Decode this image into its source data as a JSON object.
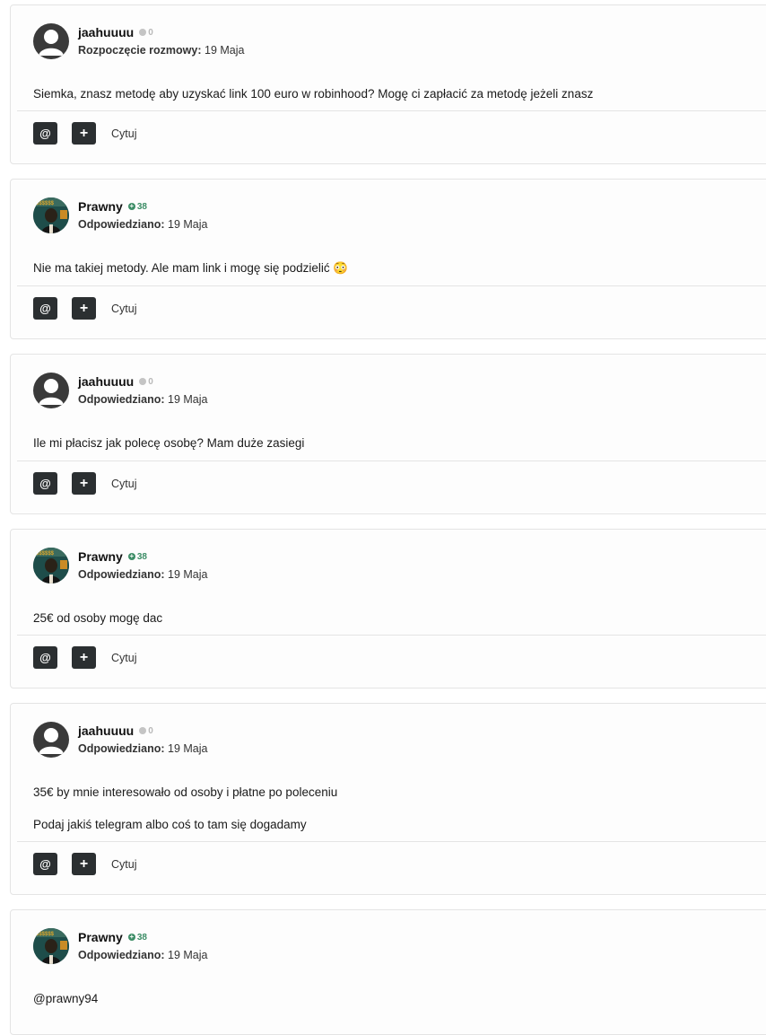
{
  "posts": [
    {
      "author": "jaahuuuu",
      "avatar_type": "default-avatar",
      "reputation": "0",
      "rep_type": "neutral",
      "meta_label": "Rozpoczęcie rozmowy:",
      "date": "19 Maja",
      "paragraphs": [
        "Siemka, znasz metodę aby uzyskać link 100 euro w robinhood? Mogę ci zapłacić za metodę jeżeli znasz"
      ]
    },
    {
      "author": "Prawny",
      "avatar_type": "photo-avatar",
      "reputation": "38",
      "rep_type": "positive",
      "meta_label": "Odpowiedziano:",
      "date": "19 Maja",
      "paragraphs": [
        "Nie ma takiej metody. Ale mam link i mogę się podzielić 😳"
      ]
    },
    {
      "author": "jaahuuuu",
      "avatar_type": "default-avatar",
      "reputation": "0",
      "rep_type": "neutral",
      "meta_label": "Odpowiedziano:",
      "date": "19 Maja",
      "paragraphs": [
        "Ile mi płacisz jak polecę osobę? Mam duże zasiegi"
      ]
    },
    {
      "author": "Prawny",
      "avatar_type": "photo-avatar",
      "reputation": "38",
      "rep_type": "positive",
      "meta_label": "Odpowiedziano:",
      "date": "19 Maja",
      "paragraphs": [
        "25€ od osoby mogę dac"
      ]
    },
    {
      "author": "jaahuuuu",
      "avatar_type": "default-avatar",
      "reputation": "0",
      "rep_type": "neutral",
      "meta_label": "Odpowiedziano:",
      "date": "19 Maja",
      "paragraphs": [
        "35€  by mnie interesowało od osoby i płatne po poleceniu",
        "Podaj jakiś telegram albo coś to tam się dogadamy"
      ]
    },
    {
      "author": "Prawny",
      "avatar_type": "photo-avatar",
      "reputation": "38",
      "rep_type": "positive",
      "meta_label": "Odpowiedziano:",
      "date": "19 Maja",
      "paragraphs": [
        "@prawny94"
      ]
    }
  ],
  "actions": {
    "mention_label": "@",
    "plus_label": "+",
    "quote_label": "Cytuj"
  },
  "colors": {
    "button_bg": "#2b2f31",
    "positive_rep": "#3c8d66",
    "neutral_rep": "#b8b8b8"
  }
}
